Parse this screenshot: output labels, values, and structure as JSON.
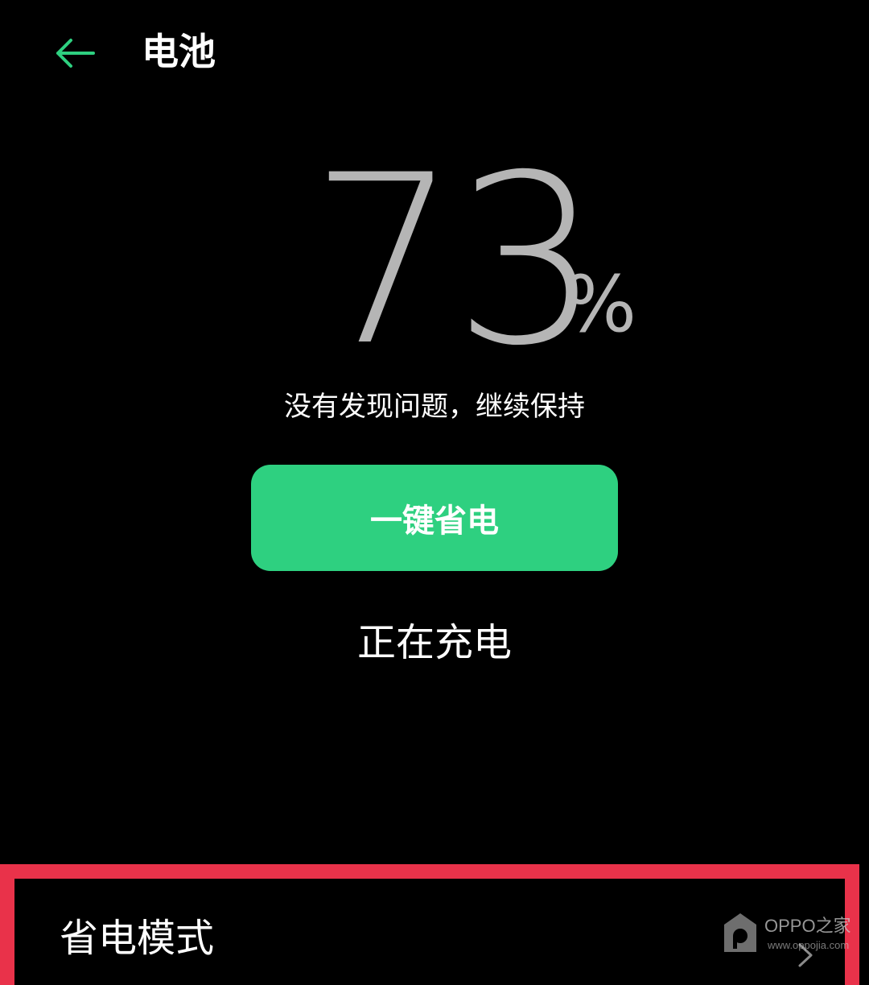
{
  "header": {
    "back_icon": "arrow-left-icon",
    "title": "电池"
  },
  "battery": {
    "level": "73",
    "unit": "%",
    "status_message": "没有发现问题，继续保持"
  },
  "actions": {
    "save_power_label": "一键省电"
  },
  "charging": {
    "status": "正在充电"
  },
  "settings": {
    "power_saving_mode_label": "省电模式"
  },
  "watermark": {
    "brand": "OPPO之家",
    "url": "www.oppojia.com"
  },
  "colors": {
    "accent": "#2ed080",
    "highlight": "#e9324a",
    "background": "#000000",
    "level_text": "#b5b5b5"
  }
}
